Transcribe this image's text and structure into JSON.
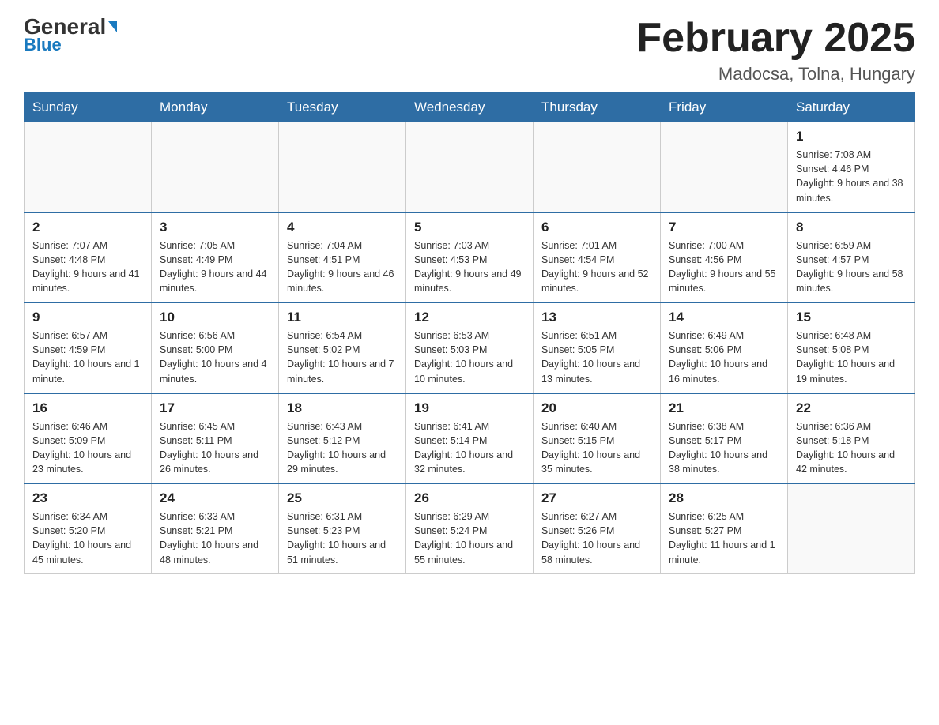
{
  "header": {
    "logo_top": "General",
    "logo_arrow": "▶",
    "logo_bottom": "Blue",
    "month_title": "February 2025",
    "location": "Madocsa, Tolna, Hungary"
  },
  "days_of_week": [
    "Sunday",
    "Monday",
    "Tuesday",
    "Wednesday",
    "Thursday",
    "Friday",
    "Saturday"
  ],
  "weeks": [
    [
      {
        "day": "",
        "info": ""
      },
      {
        "day": "",
        "info": ""
      },
      {
        "day": "",
        "info": ""
      },
      {
        "day": "",
        "info": ""
      },
      {
        "day": "",
        "info": ""
      },
      {
        "day": "",
        "info": ""
      },
      {
        "day": "1",
        "info": "Sunrise: 7:08 AM\nSunset: 4:46 PM\nDaylight: 9 hours and 38 minutes."
      }
    ],
    [
      {
        "day": "2",
        "info": "Sunrise: 7:07 AM\nSunset: 4:48 PM\nDaylight: 9 hours and 41 minutes."
      },
      {
        "day": "3",
        "info": "Sunrise: 7:05 AM\nSunset: 4:49 PM\nDaylight: 9 hours and 44 minutes."
      },
      {
        "day": "4",
        "info": "Sunrise: 7:04 AM\nSunset: 4:51 PM\nDaylight: 9 hours and 46 minutes."
      },
      {
        "day": "5",
        "info": "Sunrise: 7:03 AM\nSunset: 4:53 PM\nDaylight: 9 hours and 49 minutes."
      },
      {
        "day": "6",
        "info": "Sunrise: 7:01 AM\nSunset: 4:54 PM\nDaylight: 9 hours and 52 minutes."
      },
      {
        "day": "7",
        "info": "Sunrise: 7:00 AM\nSunset: 4:56 PM\nDaylight: 9 hours and 55 minutes."
      },
      {
        "day": "8",
        "info": "Sunrise: 6:59 AM\nSunset: 4:57 PM\nDaylight: 9 hours and 58 minutes."
      }
    ],
    [
      {
        "day": "9",
        "info": "Sunrise: 6:57 AM\nSunset: 4:59 PM\nDaylight: 10 hours and 1 minute."
      },
      {
        "day": "10",
        "info": "Sunrise: 6:56 AM\nSunset: 5:00 PM\nDaylight: 10 hours and 4 minutes."
      },
      {
        "day": "11",
        "info": "Sunrise: 6:54 AM\nSunset: 5:02 PM\nDaylight: 10 hours and 7 minutes."
      },
      {
        "day": "12",
        "info": "Sunrise: 6:53 AM\nSunset: 5:03 PM\nDaylight: 10 hours and 10 minutes."
      },
      {
        "day": "13",
        "info": "Sunrise: 6:51 AM\nSunset: 5:05 PM\nDaylight: 10 hours and 13 minutes."
      },
      {
        "day": "14",
        "info": "Sunrise: 6:49 AM\nSunset: 5:06 PM\nDaylight: 10 hours and 16 minutes."
      },
      {
        "day": "15",
        "info": "Sunrise: 6:48 AM\nSunset: 5:08 PM\nDaylight: 10 hours and 19 minutes."
      }
    ],
    [
      {
        "day": "16",
        "info": "Sunrise: 6:46 AM\nSunset: 5:09 PM\nDaylight: 10 hours and 23 minutes."
      },
      {
        "day": "17",
        "info": "Sunrise: 6:45 AM\nSunset: 5:11 PM\nDaylight: 10 hours and 26 minutes."
      },
      {
        "day": "18",
        "info": "Sunrise: 6:43 AM\nSunset: 5:12 PM\nDaylight: 10 hours and 29 minutes."
      },
      {
        "day": "19",
        "info": "Sunrise: 6:41 AM\nSunset: 5:14 PM\nDaylight: 10 hours and 32 minutes."
      },
      {
        "day": "20",
        "info": "Sunrise: 6:40 AM\nSunset: 5:15 PM\nDaylight: 10 hours and 35 minutes."
      },
      {
        "day": "21",
        "info": "Sunrise: 6:38 AM\nSunset: 5:17 PM\nDaylight: 10 hours and 38 minutes."
      },
      {
        "day": "22",
        "info": "Sunrise: 6:36 AM\nSunset: 5:18 PM\nDaylight: 10 hours and 42 minutes."
      }
    ],
    [
      {
        "day": "23",
        "info": "Sunrise: 6:34 AM\nSunset: 5:20 PM\nDaylight: 10 hours and 45 minutes."
      },
      {
        "day": "24",
        "info": "Sunrise: 6:33 AM\nSunset: 5:21 PM\nDaylight: 10 hours and 48 minutes."
      },
      {
        "day": "25",
        "info": "Sunrise: 6:31 AM\nSunset: 5:23 PM\nDaylight: 10 hours and 51 minutes."
      },
      {
        "day": "26",
        "info": "Sunrise: 6:29 AM\nSunset: 5:24 PM\nDaylight: 10 hours and 55 minutes."
      },
      {
        "day": "27",
        "info": "Sunrise: 6:27 AM\nSunset: 5:26 PM\nDaylight: 10 hours and 58 minutes."
      },
      {
        "day": "28",
        "info": "Sunrise: 6:25 AM\nSunset: 5:27 PM\nDaylight: 11 hours and 1 minute."
      },
      {
        "day": "",
        "info": ""
      }
    ]
  ]
}
